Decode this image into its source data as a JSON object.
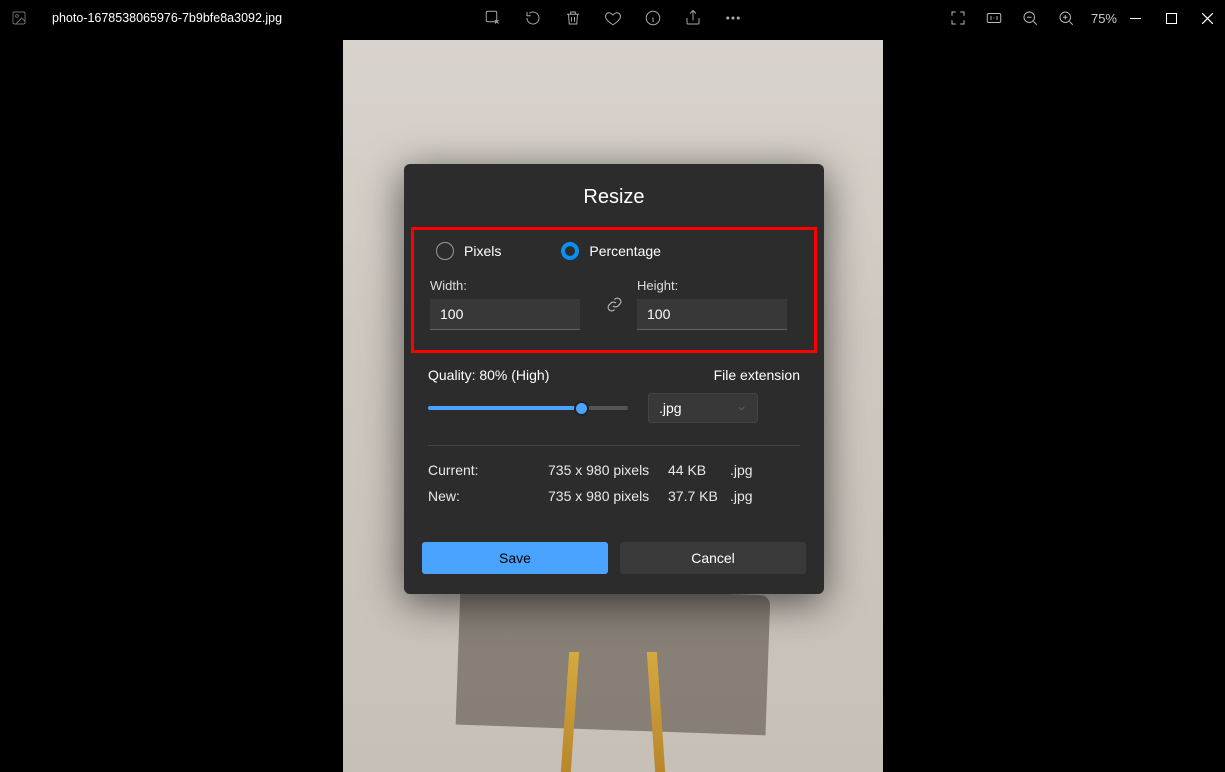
{
  "titlebar": {
    "filename": "photo-1678538065976-7b9bfe8a3092.jpg",
    "zoom_level": "75%"
  },
  "dialog": {
    "title": "Resize",
    "radio": {
      "pixels": "Pixels",
      "percentage": "Percentage"
    },
    "width_label": "Width:",
    "height_label": "Height:",
    "width_value": "100",
    "height_value": "100",
    "quality_label": "Quality: 80% (High)",
    "file_ext_label": "File extension",
    "file_ext_value": ".jpg",
    "info": {
      "current_label": "Current:",
      "new_label": "New:",
      "current_dim": "735 x 980 pixels",
      "current_size": "44 KB",
      "current_ext": ".jpg",
      "new_dim": "735 x 980 pixels",
      "new_size": "37.7 KB",
      "new_ext": ".jpg"
    },
    "save_label": "Save",
    "cancel_label": "Cancel"
  }
}
